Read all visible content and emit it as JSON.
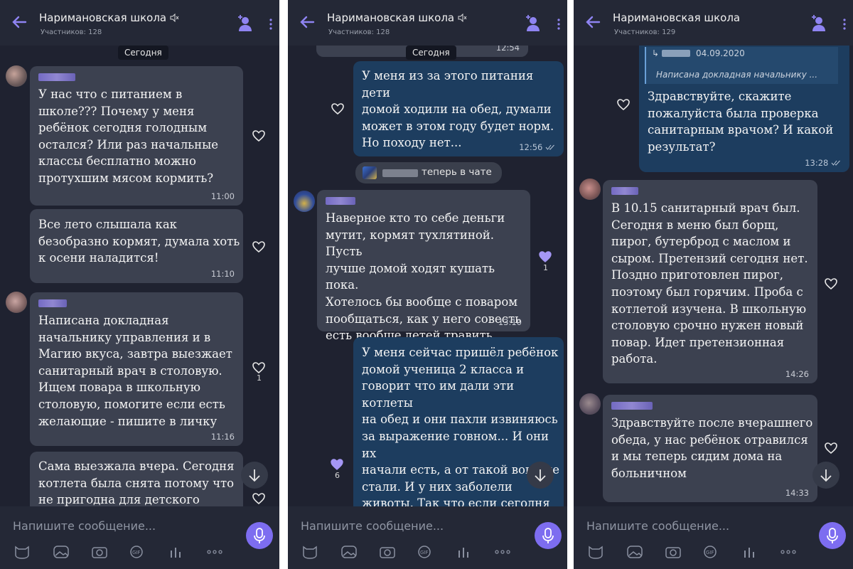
{
  "panels": [
    {
      "title": "Наримановская школа",
      "subtitle": "Участников: 128",
      "date_pill": "Сегодня",
      "messages": [
        {
          "text": "У нас что с питанием в\nшколе??? Почему у меня\nребёнок сегодня голодным\nостался? Или раз начальные\nклассы бесплатно можно\nпротухшим мясом кормить?",
          "time": "11:00"
        },
        {
          "text": "Все лето слышала как\nбезобразно кормят, думала хоть\nк осени наладится!",
          "time": "11:10"
        },
        {
          "text": "Написана докладная\nначальнику управления и в\nМагию вкуса, завтра выезжает\nсанитарный врач в столовую.\nИщем повара в школьную\nстоловую, помогите если есть\nжелающие - пишите в личку",
          "time": "11:16",
          "likes": "1"
        },
        {
          "text": "Сама выезжала вчера. Сегодня\nкотлета была снята потому что\nне пригодна для детского",
          "time": ""
        }
      ],
      "composer_placeholder": "Напишите сообщение..."
    },
    {
      "title": "Наримановская школа",
      "subtitle": "Участников: 128",
      "date_pill": "Сегодня",
      "prev_time": "12:54",
      "messages": [
        {
          "text": "У меня из за этого питания дети\nдомой ходили на обед, думали\nможет в этом году будет норм.\nНо походу нет...",
          "time": "12:56"
        },
        {
          "text": "Наверное кто то себе деньги\nмутит, кормят тухлятиной. Пусть\nлучше домой ходят кушать пока.\nХотелось бы вообще с поваром\nпообщаться, как у него совесть\nесть вообще детей травить",
          "time": "13:10",
          "likes": "1"
        },
        {
          "text": "У меня сейчас пришёл ребёнок\nдомой ученица 2 класса и\nговорит что им дали эти котлеты\nна обед и они пахли извиняюсь\nза выражение говном... И они их\nначали есть, а от такой вони не\nстали. И у них заболели\nживоты. Так что если сегодня\nребёнка что то случится с\nживотом я отвезу ребёнка в",
          "time": "",
          "likes": "6"
        }
      ],
      "joined_text": "теперь в чате",
      "composer_placeholder": "Напишите сообщение..."
    },
    {
      "title": "Наримановская школа",
      "subtitle": "Участников: 129",
      "quote_date": "04.09.2020",
      "quote_text": "Написана докладная начальнику ...",
      "messages": [
        {
          "text": "Здравствуйте, скажите\nпожалуйста была проверка\nсанитарным врачом? И какой\nрезультат?",
          "time": "13:28"
        },
        {
          "text": "В 10.15 санитарный врач был.\nСегодня в меню был борщ,\nпирог, бутерброд с маслом и\nсыром. Претензий сегодня нет.\nПоздно приготовлен пирог,\nпоэтому был горячим. Проба с\nкотлетой изучена. В школьную\nстоловую срочно нужен новый\nповар. Идет претензионная\nработа.",
          "time": "14:26"
        },
        {
          "text": "Здравствуйте после вчерашнего\nобеда, у нас ребёнок отравился\nи мы теперь сидим дома на\nбольничном",
          "time": "14:33"
        }
      ],
      "composer_placeholder": "Напишите сообщение..."
    }
  ],
  "colors": {
    "background": "#1f2230",
    "incoming_bubble": "#3c4150",
    "outgoing_bubble": "#1d3d5f",
    "accent": "#7d6df0"
  },
  "icons": [
    "back-arrow-icon",
    "muted-speaker-icon",
    "add-participant-icon",
    "more-icon",
    "heart-icon",
    "scroll-down-icon",
    "microphone-icon",
    "sticker-icon",
    "gallery-icon",
    "camera-icon",
    "gif-icon",
    "poll-icon",
    "more-options-icon"
  ]
}
